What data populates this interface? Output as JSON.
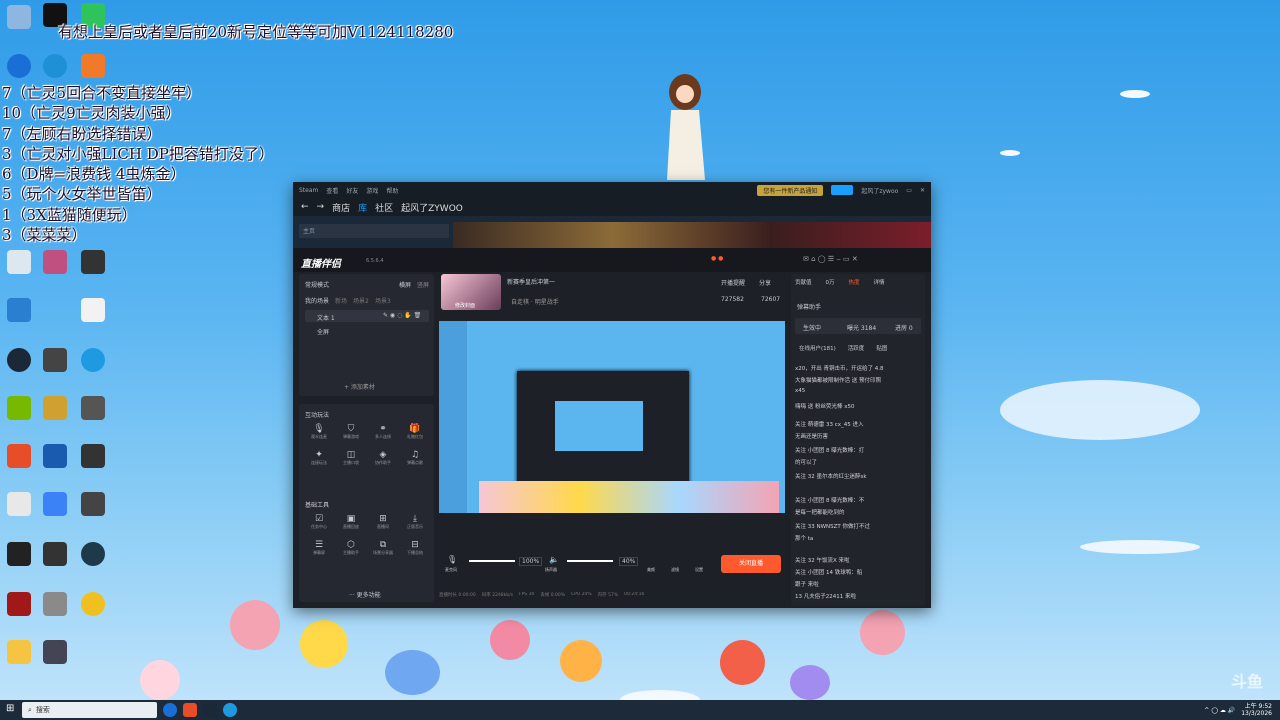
{
  "overlay": {
    "top_line": "有想上皇后或者皇后前20新号定位等等可加V1124118280",
    "lines": [
      "7（亡灵5回合不变直接坐牢）",
      "10（亡灵9亡灵肉装小强）",
      "7（左顾右盼选择错误）",
      "3（亡灵对小强LICH DP把容错打没了）",
      "6（D牌=浪费钱  4虫炼金）",
      "5（玩个火女举世皆笛）",
      "1（3X蓝猫随便玩）",
      "3（菜菜菜）"
    ]
  },
  "steam": {
    "topbar": [
      "Steam",
      "查看",
      "好友",
      "游戏",
      "帮助"
    ],
    "promo": "您有一件新产品通知",
    "user": "起风了zywoo",
    "nav": [
      "商店",
      "库",
      "社区",
      "起风了ZYWOO"
    ],
    "active_nav": "库",
    "home": "主页"
  },
  "zhibo": {
    "logo": "直播伴侣",
    "version": "6.5.6.4",
    "mode": "常规模式",
    "mode_tabs": [
      "横屏",
      "竖屏"
    ],
    "scene_title": "我的场景",
    "scene_tabs": [
      "新场",
      "场景2",
      "场景3"
    ],
    "sources": [
      "文本 1",
      "全屏"
    ],
    "add_source": "+ 添加素材",
    "interact_title": "互动玩法",
    "interact_items": [
      "观众连麦",
      "弹幕游戏",
      "多人连线",
      "礼物红包",
      "连接玩法",
      "主播口袋",
      "协作助手",
      "弹幕点歌"
    ],
    "tools_title": "基础工具",
    "tools_items": [
      "任务中心",
      "直播回放",
      "直播间",
      "正版音乐",
      "弹幕屏",
      "主播助手",
      "场景分享器",
      "下播总结"
    ],
    "more": "··· 更多功能",
    "stream_title": "新赛季皇后冲第一",
    "stream_sub": "修改封面",
    "category": "自走棋 · 明星战手",
    "stats": [
      "开播提醒",
      "分享"
    ],
    "viewers": "727582",
    "likes": "72607",
    "mic_label": "麦克风",
    "mic_pct": "100%",
    "spk_label": "扬声器",
    "spk_pct": "40%",
    "btns": [
      "美颜",
      "滤镜",
      "设置"
    ],
    "start_btn": "关闭直播",
    "status": [
      "直播时长 0:00:00",
      "码率 2248kb/s",
      "FPS 30",
      "丢帧 0.00%",
      "CPU 20%",
      "内存 57%",
      "00:24:16"
    ],
    "right_tabs": [
      "贡献值",
      "0万",
      "热度",
      "详情"
    ],
    "right_title": "弹幕助手",
    "right_stat_a": "生效中",
    "right_stat_b": "曝光 3184",
    "right_stat_c": "进房 0",
    "online_tabs": [
      "在线用户(181)",
      "活跃度",
      "贴图"
    ],
    "chat": [
      "x20，开出 青铜击币，开运给了 4.8",
      "大象猫猫都被限制作活 送 预付印照",
      "x45",
      "嗨嗨 送 粉丝荧光棒 x50",
      "关注 萌德雷  33  cx_45  进入",
      "无画还是历害",
      "关注 小团团  8  曝光数棒：打",
      "的可以了",
      "关注 32  墨尔本的红尘迷醉sk",
      "关注 小团团  8  曝光数棒：不",
      "是每一把都能吃到的",
      "关注 33  NWNSZT 你做打不过",
      "那个 ta",
      "关注 32  午饭流X 来啦",
      "关注 小团团  14  铁球鸭：船",
      "跟子 来啦",
      "13  凡夫俗子22411 来啦"
    ]
  },
  "taskbar": {
    "search": "搜索",
    "time": "上午 9:52",
    "date": "13/3/2026"
  },
  "watermark": "斗鱼",
  "colors": {
    "accent": "#ff5a2e",
    "steam_blue": "#1a9fff",
    "desktop_sky": "#5cb6f2"
  }
}
